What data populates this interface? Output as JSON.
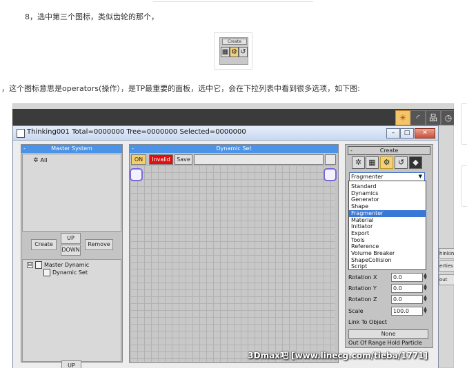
{
  "article": {
    "step_text": "8，选中第三个图标，类似齿轮的那个，",
    "description": "，这个图标意思是operators(操作），是TP最重要的面板，选中它，会在下拉列表中看到很多选项，如下图:",
    "thumbnail": {
      "title": "Create"
    }
  },
  "window": {
    "title": "Thinking001  Total=0000000  Tree=0000000  Selected=0000000",
    "controls": {
      "minimize": "–",
      "maximize": "□",
      "close": "✕"
    }
  },
  "master_system": {
    "header": "Master System",
    "collapse": "-",
    "tree_root": "All",
    "buttons": {
      "create": "Create",
      "up": "UP",
      "down": "DOWN",
      "remove": "Remove"
    },
    "dynamic_tree": {
      "parent": "Master Dynamic",
      "child": "Dynamic Set",
      "toggle": "⊟"
    },
    "bottom_up": "UP"
  },
  "dynamic_set": {
    "header": "Dynamic Set",
    "collapse": "-",
    "on_label": "ON",
    "invalid_label": "Invalid",
    "save_label": "Save"
  },
  "create_panel": {
    "header": "Create",
    "collapse": "-",
    "selected_value": "Fragmenter",
    "options": [
      "Standard",
      "Dynamics",
      "Generator",
      "Shape",
      "Fragmenter",
      "Material",
      "Initiator",
      "Export",
      "Tools",
      "Reference",
      "Volume Breaker",
      "ShapeCollision",
      "Script"
    ],
    "selected_index": 4,
    "fields": [
      {
        "label": "Rotation X",
        "value": "0.0"
      },
      {
        "label": "Rotation Y",
        "value": "0.0"
      },
      {
        "label": "Rotation Z",
        "value": "0.0"
      },
      {
        "label": "Scale",
        "value": "100.0"
      }
    ],
    "link_label": "Link To Object",
    "none_button": "None",
    "out_of_range": "Out Of Range Hold Particle"
  },
  "bleed_labels": [
    "hinking",
    "erties",
    "out"
  ],
  "watermark": "3Dmax吧  [www.linecg.com/tieba/1771]",
  "colors": {
    "panel_header": "#4a93e8",
    "on_button": "#f3d06b",
    "invalid_button": "#e01010",
    "node_border": "#7b66d6",
    "selected_item": "#3a78d8"
  }
}
